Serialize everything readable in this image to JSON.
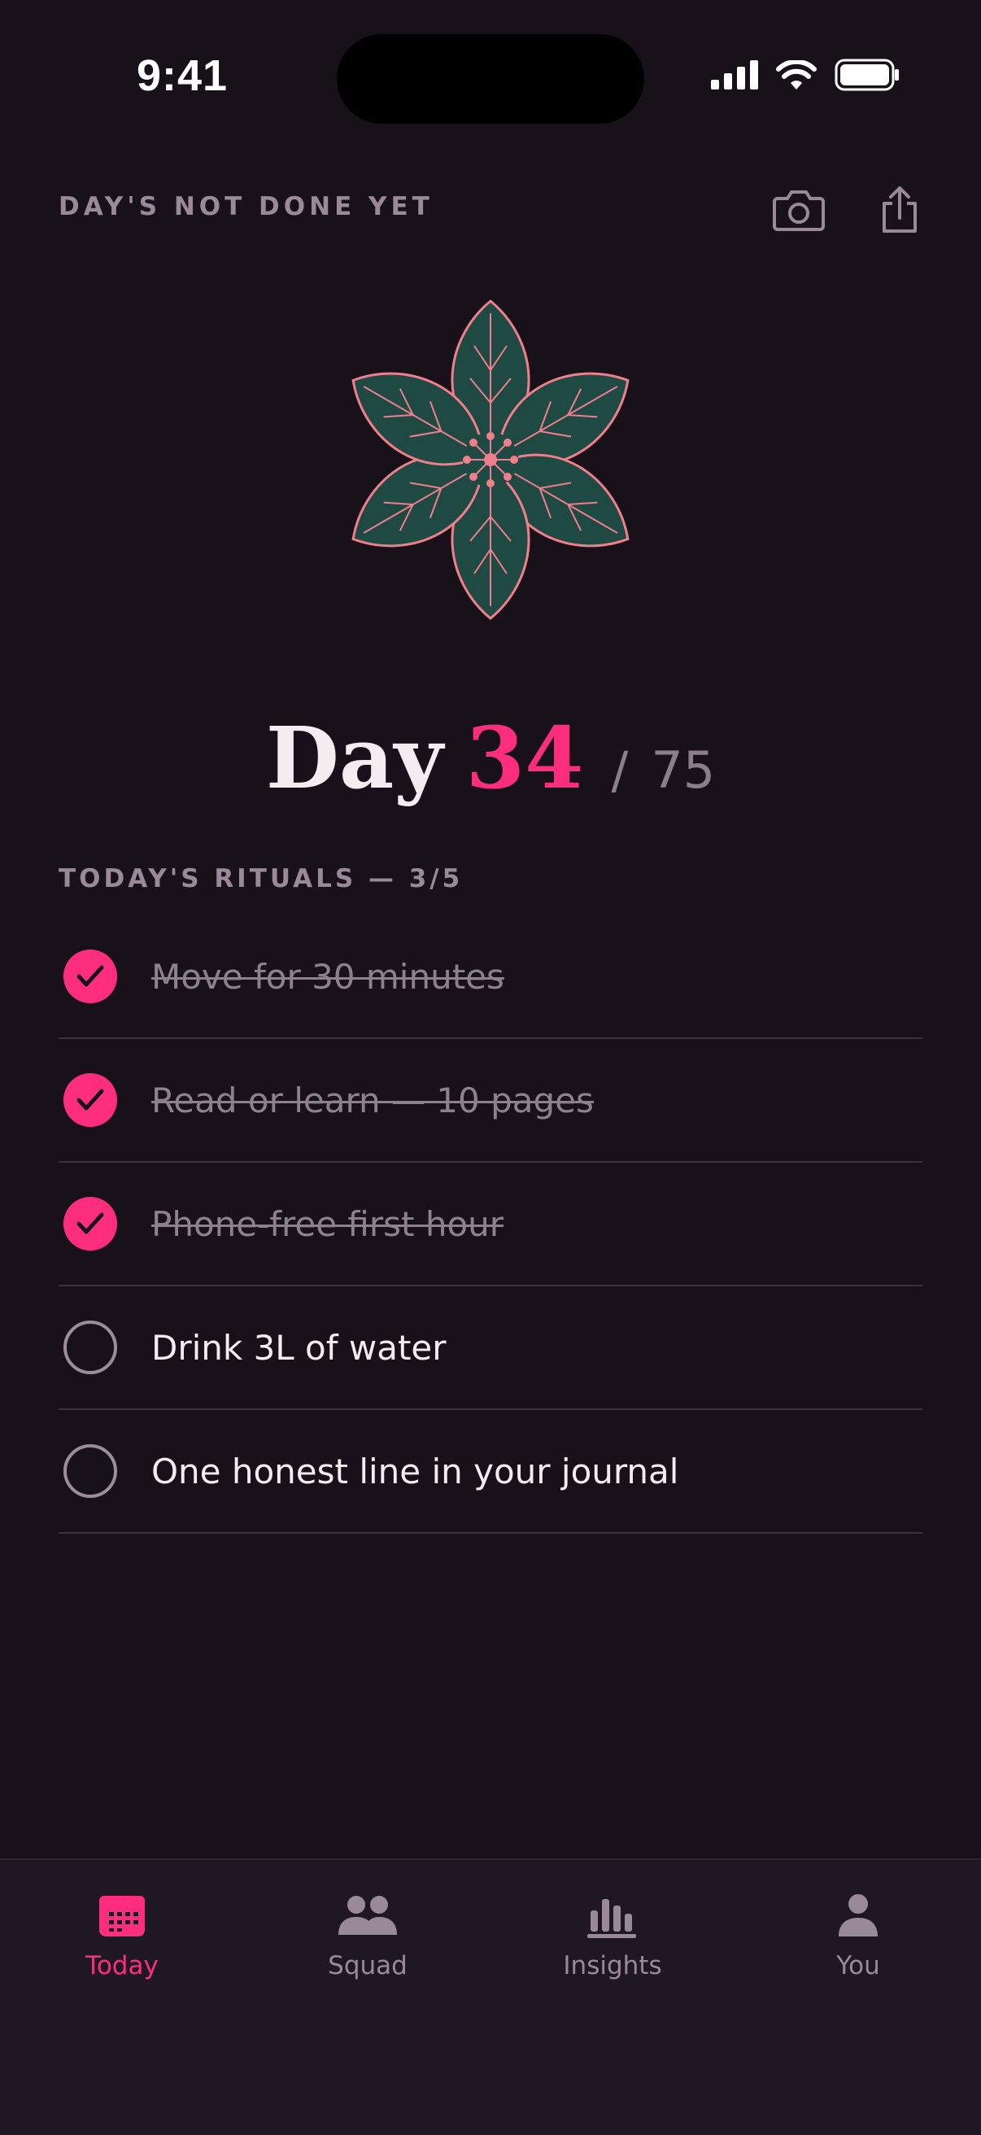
{
  "status_bar": {
    "time": "9:41"
  },
  "header": {
    "status_label": "DAY'S NOT DONE YET"
  },
  "icons": {
    "camera": "camera-icon",
    "share": "share-icon"
  },
  "challenge": {
    "day_word": "Day",
    "current_day": "34",
    "separator": "/",
    "total_days": "75"
  },
  "rituals": {
    "title": "TODAY'S RITUALS — 3/5",
    "items": [
      {
        "label": "Move for 30 minutes",
        "done": true
      },
      {
        "label": "Read or learn — 10 pages",
        "done": true
      },
      {
        "label": "Phone-free first hour",
        "done": true
      },
      {
        "label": "Drink 3L of water",
        "done": false
      },
      {
        "label": "One honest line in your journal",
        "done": false
      }
    ]
  },
  "tabs": [
    {
      "label": "Today",
      "icon": "calendar-icon",
      "active": true
    },
    {
      "label": "Squad",
      "icon": "people-icon",
      "active": false
    },
    {
      "label": "Insights",
      "icon": "bar-chart-icon",
      "active": false
    },
    {
      "label": "You",
      "icon": "person-icon",
      "active": false
    }
  ],
  "colors": {
    "accent": "#ff2d7e",
    "background": "#18111a",
    "leaf": "#1f4a43",
    "leaf_stroke": "#f07f8b"
  }
}
